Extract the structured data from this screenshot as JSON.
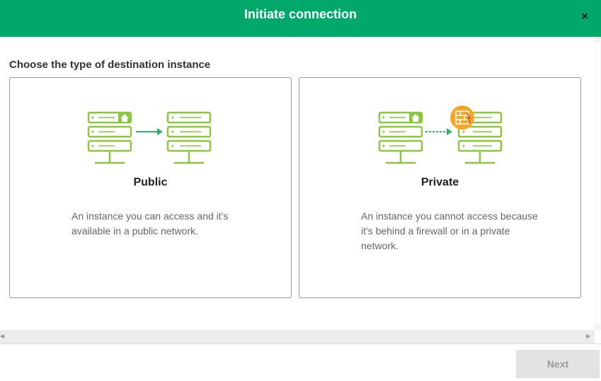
{
  "dialog": {
    "title": "Initiate connection",
    "close_icon": "×"
  },
  "main": {
    "section_title": "Choose the type of destination instance",
    "options": [
      {
        "title": "Public",
        "description": "An instance you can access and it's available in a public network.",
        "illustration": "public-servers-arrow"
      },
      {
        "title": "Private",
        "description": "An instance you cannot access because it's behind a firewall or in a private network.",
        "illustration": "private-servers-firewall"
      }
    ]
  },
  "footer": {
    "next_label": "Next"
  },
  "colors": {
    "header": "#00a86b",
    "server_outline": "#8cc63f",
    "arrow": "#2db36b",
    "firewall": "#f5a623"
  }
}
